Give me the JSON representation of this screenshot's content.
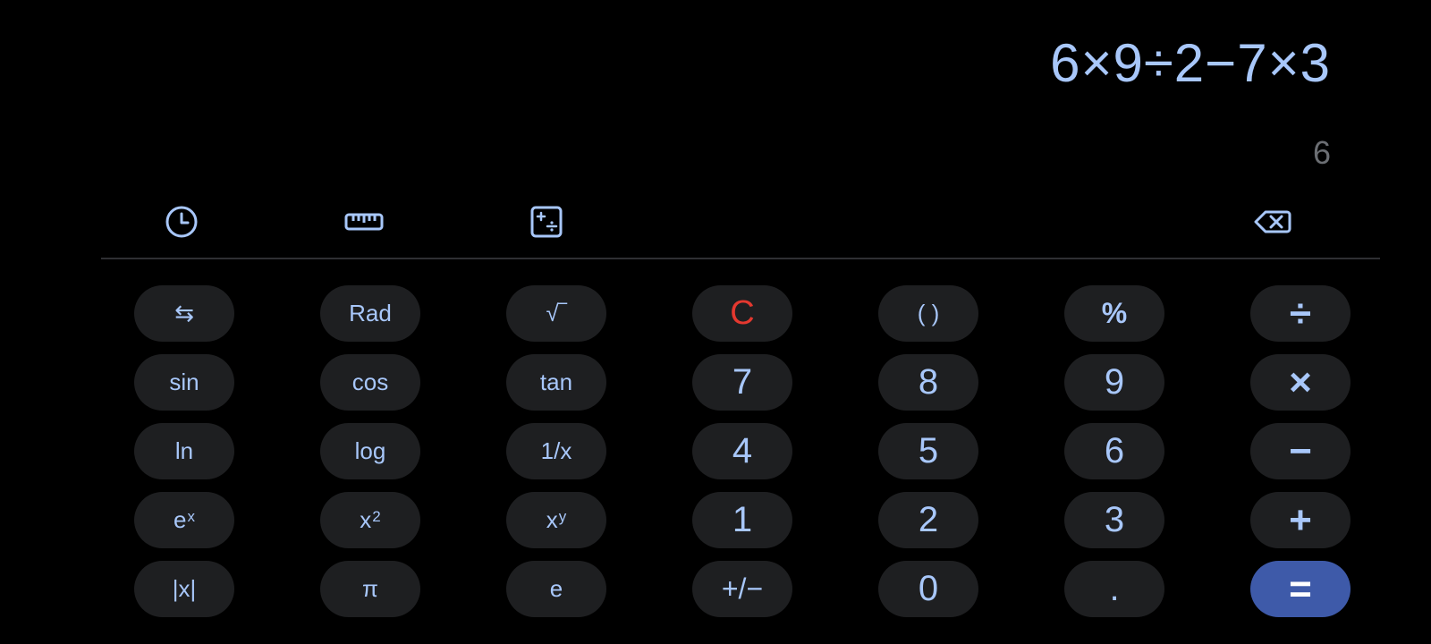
{
  "display": {
    "expression": "6×9÷2−7×3",
    "result": "6"
  },
  "toolbar": {
    "history_icon": "history-clock-icon",
    "converter_icon": "ruler-icon",
    "mode_icon": "calculator-ops-icon",
    "backspace_icon": "backspace-icon"
  },
  "keys": {
    "swap": "⇆",
    "rad": "Rad",
    "sqrt": "√‾",
    "clear": "C",
    "parens": "( )",
    "percent": "%",
    "divide": "÷",
    "sin": "sin",
    "cos": "cos",
    "tan": "tan",
    "seven": "7",
    "eight": "8",
    "nine": "9",
    "multiply": "×",
    "ln": "ln",
    "log": "log",
    "reciprocal": "1/x",
    "four": "4",
    "five": "5",
    "six": "6",
    "minus": "−",
    "exp_base": "e",
    "exp_sup": "x",
    "square_base": "x",
    "square_sup": "2",
    "power_base": "x",
    "power_sup": "y",
    "one": "1",
    "two": "2",
    "three": "3",
    "plus": "+",
    "abs": "|x|",
    "pi": "π",
    "e": "e",
    "negate": "+/−",
    "zero": "0",
    "dot": ".",
    "equals": "="
  },
  "colors": {
    "background": "#000000",
    "key_background": "#1e1f21",
    "key_text": "#a8c7fa",
    "clear_text": "#e4382f",
    "equals_background": "#3e5aa9",
    "result_text": "#6b6e73"
  }
}
